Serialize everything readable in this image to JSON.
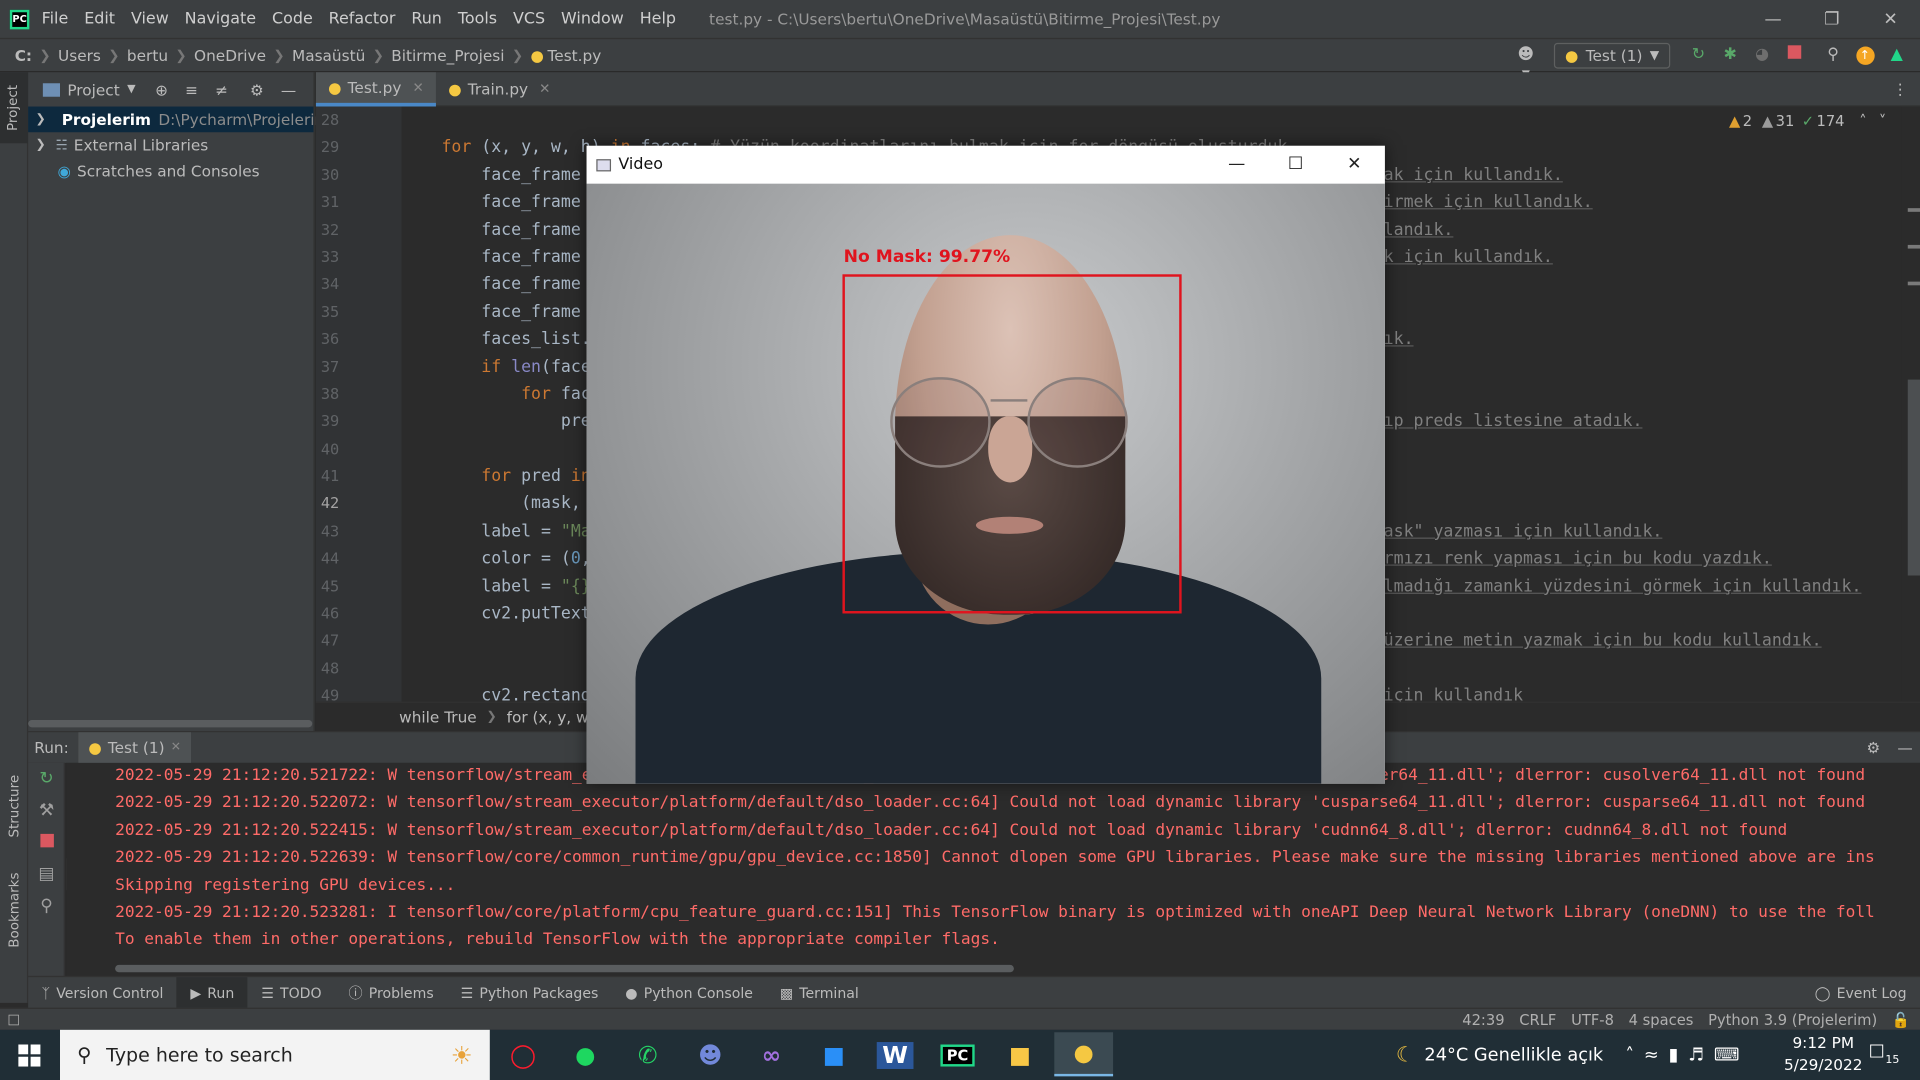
{
  "app": {
    "menu": [
      "File",
      "Edit",
      "View",
      "Navigate",
      "Code",
      "Refactor",
      "Run",
      "Tools",
      "VCS",
      "Window",
      "Help"
    ],
    "title_path": "test.py - C:\\Users\\bertu\\OneDrive\\Masaüstü\\Bitirme_Projesi\\Test.py"
  },
  "breadcrumb": [
    "C:",
    "Users",
    "bertu",
    "OneDrive",
    "Masaüstü",
    "Bitirme_Projesi",
    "Test.py"
  ],
  "run_config": "Test (1)",
  "project_panel": {
    "title": "Project",
    "tree": [
      {
        "name": "Projelerim",
        "path": "D:\\Pycharm\\Projelerim"
      },
      {
        "name": "External Libraries",
        "path": ""
      },
      {
        "name": "Scratches and Consoles",
        "path": ""
      }
    ]
  },
  "left_strip": {
    "project": "Project",
    "structure": "Structure",
    "bookmarks": "Bookmarks"
  },
  "tabs": [
    {
      "label": "Test.py",
      "active": true
    },
    {
      "label": "Train.py",
      "active": false
    }
  ],
  "inspection": {
    "warnings_a": "2",
    "warnings_b": "31",
    "ok": "174"
  },
  "line_numbers": [
    "28",
    "29",
    "30",
    "31",
    "32",
    "33",
    "34",
    "35",
    "36",
    "37",
    "38",
    "39",
    "40",
    "41",
    "42",
    "43",
    "44",
    "45",
    "46",
    "47",
    "48",
    "49"
  ],
  "code_lines": [
    {
      "text": "",
      "right": ""
    },
    {
      "text": "    for (x, y, w, h) in faces: # Yüzün koordinatlarını bulmak için for döngüsü oluşturduk.",
      "right": ""
    },
    {
      "text": "        face_frame",
      "right": "ak için kullandık."
    },
    {
      "text": "        face_frame",
      "right": "irmek için kullandık."
    },
    {
      "text": "        face_frame",
      "right": "landık."
    },
    {
      "text": "        face_frame",
      "right": "k için kullandık."
    },
    {
      "text": "        face_frame",
      "right": ""
    },
    {
      "text": "        face_frame",
      "right": ""
    },
    {
      "text": "        faces_list.",
      "right": "ık."
    },
    {
      "text": "        if len(face",
      "right": ""
    },
    {
      "text": "            for fac",
      "right": ""
    },
    {
      "text": "                pre",
      "right": "ıp preds listesine atadık."
    },
    {
      "text": "",
      "right": ""
    },
    {
      "text": "        for pred in",
      "right": ""
    },
    {
      "text": "            (mask,",
      "right": ""
    },
    {
      "text": "        label = \"Ma",
      "right": "ask\" yazması için kullandık."
    },
    {
      "text": "        color = (0,",
      "right": "rmızı renk yapması için bu kodu yazdık."
    },
    {
      "text": "        label = \"{}",
      "right": "lmadığı zamanki yüzdesini görmek için kullandık."
    },
    {
      "text": "        cv2.putText",
      "right": ""
    },
    {
      "text": "",
      "right": "üzerine metin yazmak için bu kodu kullandık."
    },
    {
      "text": "",
      "right": ""
    },
    {
      "text": "        cv2.rectang",
      "right": "için kullandık"
    }
  ],
  "editor_breadcrumb": [
    "while True",
    "for (x, y, w, h)"
  ],
  "run_panel": {
    "label": "Run:",
    "config": "Test (1)"
  },
  "console": [
    "2022-05-29 21:12:20.521722: W tensorflow/stream_executor/platform/default/dso_loader.cc:64] Could not load dynamic library 'cusolver64_11.dll'; dlerror: cusolver64_11.dll not found",
    "2022-05-29 21:12:20.522072: W tensorflow/stream_executor/platform/default/dso_loader.cc:64] Could not load dynamic library 'cusparse64_11.dll'; dlerror: cusparse64_11.dll not found",
    "2022-05-29 21:12:20.522415: W tensorflow/stream_executor/platform/default/dso_loader.cc:64] Could not load dynamic library 'cudnn64_8.dll'; dlerror: cudnn64_8.dll not found",
    "2022-05-29 21:12:20.522639: W tensorflow/core/common_runtime/gpu/gpu_device.cc:1850] Cannot dlopen some GPU libraries. Please make sure the missing libraries mentioned above are ins",
    "Skipping registering GPU devices...",
    "2022-05-29 21:12:20.523281: I tensorflow/core/platform/cpu_feature_guard.cc:151] This TensorFlow binary is optimized with oneAPI Deep Neural Network Library (oneDNN) to use the foll",
    "To enable them in other operations, rebuild TensorFlow with the appropriate compiler flags."
  ],
  "tool_windows": [
    "Version Control",
    "Run",
    "TODO",
    "Problems",
    "Python Packages",
    "Python Console",
    "Terminal"
  ],
  "event_log": "Event Log",
  "status": {
    "position": "42:39",
    "line_sep": "CRLF",
    "encoding": "UTF-8",
    "indent": "4 spaces",
    "interpreter": "Python 3.9 (Projelerim)"
  },
  "video_window": {
    "title": "Video",
    "detection_label": "No Mask: 99.77%",
    "box_color": "#e0141e"
  },
  "taskbar": {
    "search_placeholder": "Type here to search",
    "weather": "24°C  Genellikle açık",
    "time": "9:12 PM",
    "date": "5/29/2022",
    "notifications": "15"
  },
  "colors": {
    "accent": "#4a88c7",
    "error_text": "#ff6b68",
    "detection": "#e0141e"
  }
}
